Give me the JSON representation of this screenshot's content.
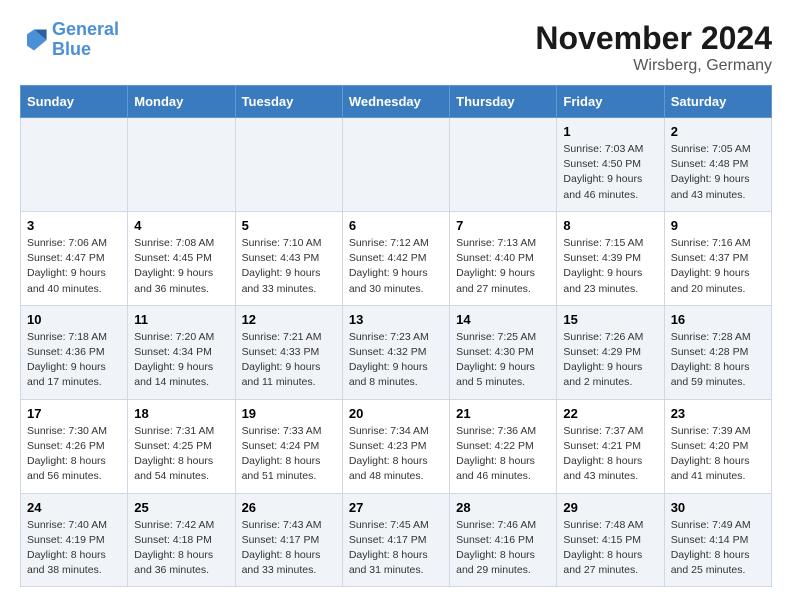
{
  "header": {
    "logo_line1": "General",
    "logo_line2": "Blue",
    "month": "November 2024",
    "location": "Wirsberg, Germany"
  },
  "weekdays": [
    "Sunday",
    "Monday",
    "Tuesday",
    "Wednesday",
    "Thursday",
    "Friday",
    "Saturday"
  ],
  "weeks": [
    [
      {
        "day": "",
        "info": ""
      },
      {
        "day": "",
        "info": ""
      },
      {
        "day": "",
        "info": ""
      },
      {
        "day": "",
        "info": ""
      },
      {
        "day": "",
        "info": ""
      },
      {
        "day": "1",
        "info": "Sunrise: 7:03 AM\nSunset: 4:50 PM\nDaylight: 9 hours and 46 minutes."
      },
      {
        "day": "2",
        "info": "Sunrise: 7:05 AM\nSunset: 4:48 PM\nDaylight: 9 hours and 43 minutes."
      }
    ],
    [
      {
        "day": "3",
        "info": "Sunrise: 7:06 AM\nSunset: 4:47 PM\nDaylight: 9 hours and 40 minutes."
      },
      {
        "day": "4",
        "info": "Sunrise: 7:08 AM\nSunset: 4:45 PM\nDaylight: 9 hours and 36 minutes."
      },
      {
        "day": "5",
        "info": "Sunrise: 7:10 AM\nSunset: 4:43 PM\nDaylight: 9 hours and 33 minutes."
      },
      {
        "day": "6",
        "info": "Sunrise: 7:12 AM\nSunset: 4:42 PM\nDaylight: 9 hours and 30 minutes."
      },
      {
        "day": "7",
        "info": "Sunrise: 7:13 AM\nSunset: 4:40 PM\nDaylight: 9 hours and 27 minutes."
      },
      {
        "day": "8",
        "info": "Sunrise: 7:15 AM\nSunset: 4:39 PM\nDaylight: 9 hours and 23 minutes."
      },
      {
        "day": "9",
        "info": "Sunrise: 7:16 AM\nSunset: 4:37 PM\nDaylight: 9 hours and 20 minutes."
      }
    ],
    [
      {
        "day": "10",
        "info": "Sunrise: 7:18 AM\nSunset: 4:36 PM\nDaylight: 9 hours and 17 minutes."
      },
      {
        "day": "11",
        "info": "Sunrise: 7:20 AM\nSunset: 4:34 PM\nDaylight: 9 hours and 14 minutes."
      },
      {
        "day": "12",
        "info": "Sunrise: 7:21 AM\nSunset: 4:33 PM\nDaylight: 9 hours and 11 minutes."
      },
      {
        "day": "13",
        "info": "Sunrise: 7:23 AM\nSunset: 4:32 PM\nDaylight: 9 hours and 8 minutes."
      },
      {
        "day": "14",
        "info": "Sunrise: 7:25 AM\nSunset: 4:30 PM\nDaylight: 9 hours and 5 minutes."
      },
      {
        "day": "15",
        "info": "Sunrise: 7:26 AM\nSunset: 4:29 PM\nDaylight: 9 hours and 2 minutes."
      },
      {
        "day": "16",
        "info": "Sunrise: 7:28 AM\nSunset: 4:28 PM\nDaylight: 8 hours and 59 minutes."
      }
    ],
    [
      {
        "day": "17",
        "info": "Sunrise: 7:30 AM\nSunset: 4:26 PM\nDaylight: 8 hours and 56 minutes."
      },
      {
        "day": "18",
        "info": "Sunrise: 7:31 AM\nSunset: 4:25 PM\nDaylight: 8 hours and 54 minutes."
      },
      {
        "day": "19",
        "info": "Sunrise: 7:33 AM\nSunset: 4:24 PM\nDaylight: 8 hours and 51 minutes."
      },
      {
        "day": "20",
        "info": "Sunrise: 7:34 AM\nSunset: 4:23 PM\nDaylight: 8 hours and 48 minutes."
      },
      {
        "day": "21",
        "info": "Sunrise: 7:36 AM\nSunset: 4:22 PM\nDaylight: 8 hours and 46 minutes."
      },
      {
        "day": "22",
        "info": "Sunrise: 7:37 AM\nSunset: 4:21 PM\nDaylight: 8 hours and 43 minutes."
      },
      {
        "day": "23",
        "info": "Sunrise: 7:39 AM\nSunset: 4:20 PM\nDaylight: 8 hours and 41 minutes."
      }
    ],
    [
      {
        "day": "24",
        "info": "Sunrise: 7:40 AM\nSunset: 4:19 PM\nDaylight: 8 hours and 38 minutes."
      },
      {
        "day": "25",
        "info": "Sunrise: 7:42 AM\nSunset: 4:18 PM\nDaylight: 8 hours and 36 minutes."
      },
      {
        "day": "26",
        "info": "Sunrise: 7:43 AM\nSunset: 4:17 PM\nDaylight: 8 hours and 33 minutes."
      },
      {
        "day": "27",
        "info": "Sunrise: 7:45 AM\nSunset: 4:17 PM\nDaylight: 8 hours and 31 minutes."
      },
      {
        "day": "28",
        "info": "Sunrise: 7:46 AM\nSunset: 4:16 PM\nDaylight: 8 hours and 29 minutes."
      },
      {
        "day": "29",
        "info": "Sunrise: 7:48 AM\nSunset: 4:15 PM\nDaylight: 8 hours and 27 minutes."
      },
      {
        "day": "30",
        "info": "Sunrise: 7:49 AM\nSunset: 4:14 PM\nDaylight: 8 hours and 25 minutes."
      }
    ]
  ]
}
